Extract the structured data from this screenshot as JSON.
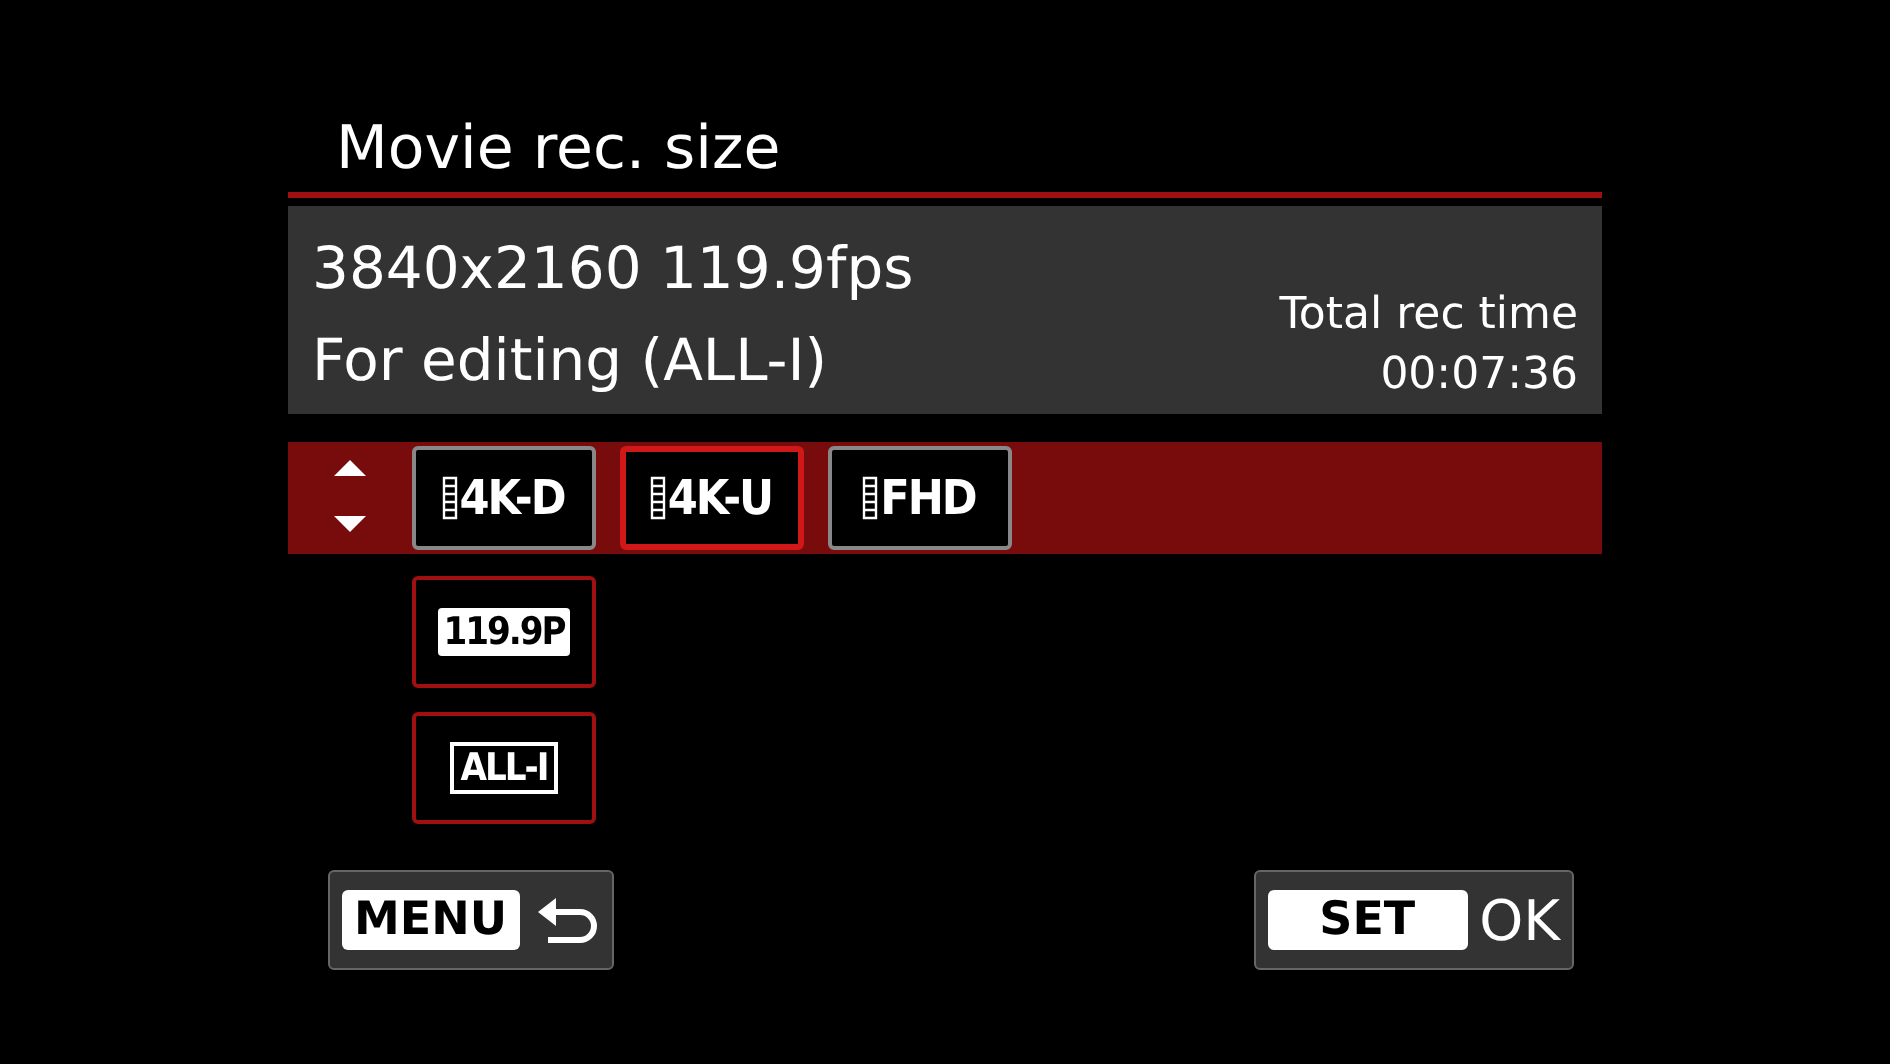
{
  "title": "Movie rec. size",
  "info": {
    "lines": [
      "3840x2160 119.9fps",
      "For editing (ALL-I)"
    ],
    "total_label": "Total rec time",
    "total_time": "00:07:36"
  },
  "rows": [
    {
      "active": true,
      "options": [
        {
          "label": "4K-D",
          "kind": "film",
          "selected": false
        },
        {
          "label": "4K-U",
          "kind": "film",
          "selected": true
        },
        {
          "label": "FHD",
          "kind": "film",
          "selected": false
        }
      ]
    },
    {
      "active": false,
      "options": [
        {
          "label": "119.9P",
          "kind": "filled",
          "selected": true
        }
      ]
    },
    {
      "active": false,
      "options": [
        {
          "label": "ALL-I",
          "kind": "outlined",
          "selected": true
        }
      ]
    }
  ],
  "buttons": {
    "menu": "MENU",
    "set": "SET",
    "ok": "OK"
  }
}
